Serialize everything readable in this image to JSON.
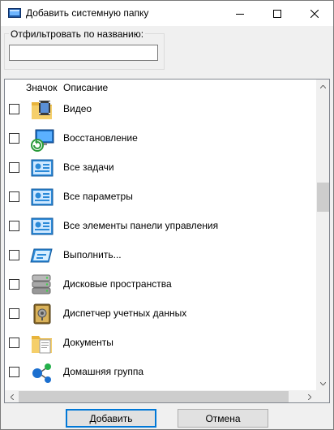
{
  "window": {
    "title": "Добавить системную папку"
  },
  "filter": {
    "label": "Отфильтровать по названию:",
    "value": "",
    "placeholder": ""
  },
  "columns": {
    "icon": "Значок",
    "description": "Описание"
  },
  "items": [
    {
      "label": "Видео",
      "icon": "video-folder-icon",
      "checked": false
    },
    {
      "label": "Восстановление",
      "icon": "recovery-icon",
      "checked": false
    },
    {
      "label": "Все задачи",
      "icon": "control-panel-icon",
      "checked": false
    },
    {
      "label": "Все параметры",
      "icon": "control-panel-icon",
      "checked": false
    },
    {
      "label": "Все элементы панели управления",
      "icon": "control-panel-icon",
      "checked": false
    },
    {
      "label": "Выполнить...",
      "icon": "run-icon",
      "checked": false
    },
    {
      "label": "Дисковые пространства",
      "icon": "storage-spaces-icon",
      "checked": false
    },
    {
      "label": "Диспетчер учетных данных",
      "icon": "credential-manager-icon",
      "checked": false
    },
    {
      "label": "Документы",
      "icon": "documents-folder-icon",
      "checked": false
    },
    {
      "label": "Домашняя группа",
      "icon": "homegroup-icon",
      "checked": false
    }
  ],
  "buttons": {
    "add": "Добавить",
    "cancel": "Отмена"
  },
  "colors": {
    "accent": "#0078d7",
    "folder": "#f2c75c",
    "cp_blue": "#2b8ad8"
  }
}
